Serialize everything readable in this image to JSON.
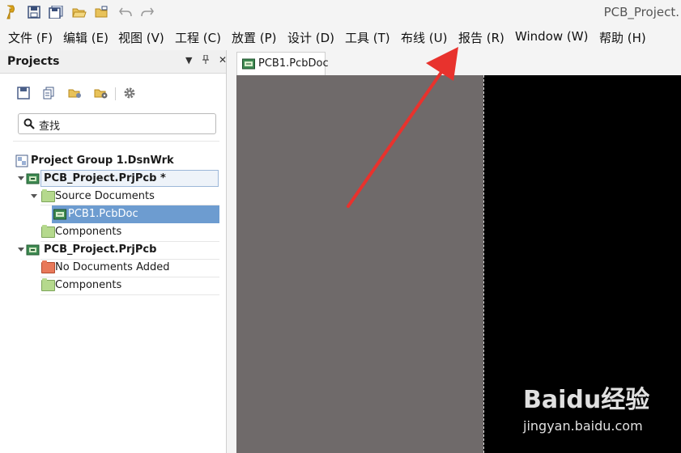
{
  "window": {
    "title": "PCB_Project."
  },
  "menu": [
    {
      "label": "文件 (F)"
    },
    {
      "label": "编辑 (E)"
    },
    {
      "label": "视图 (V)"
    },
    {
      "label": "工程 (C)"
    },
    {
      "label": "放置 (P)"
    },
    {
      "label": "设计 (D)"
    },
    {
      "label": "工具 (T)"
    },
    {
      "label": "布线 (U)"
    },
    {
      "label": "报告 (R)"
    },
    {
      "label": "Window (W)"
    },
    {
      "label": "帮助 (H)"
    }
  ],
  "panel": {
    "title": "Projects",
    "search": {
      "value": "查找"
    },
    "tree": [
      {
        "label": "Project Group 1.DsnWrk"
      },
      {
        "label": "PCB_Project.PrjPcb *"
      },
      {
        "label": "Source Documents"
      },
      {
        "label": "PCB1.PcbDoc"
      },
      {
        "label": "Components"
      },
      {
        "label": "PCB_Project.PrjPcb"
      },
      {
        "label": "No Documents Added"
      },
      {
        "label": "Components"
      }
    ]
  },
  "document": {
    "tab_label": "PCB1.PcbDoc"
  },
  "watermark": {
    "brand": "Baidu经验",
    "url": "jingyan.baidu.com"
  },
  "colors": {
    "selection": "#6d9cd0",
    "canvas": "#6f6a6a",
    "board": "#000000",
    "arrow": "#e8322d",
    "folder_green": "#b5d98d",
    "folder_red": "#e8795a"
  }
}
